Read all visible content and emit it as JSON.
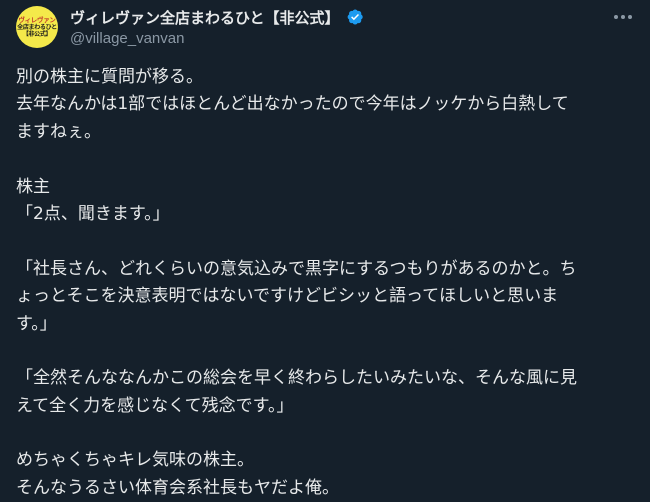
{
  "author": {
    "display_name": "ヴィレヴァン全店まわるひと【非公式】",
    "handle": "@village_vanvan",
    "avatar_text": [
      "ヴィレヴァン",
      "全店まわるひと",
      "【非公式】"
    ],
    "avatar_bg": "#f4e94a",
    "verified": true,
    "verified_color": "#1d9bf0"
  },
  "menu": {
    "icon": "more-horizontal-icon"
  },
  "tweet": {
    "lines": [
      "別の株主に質問が移る。",
      "去年なんかは1部ではほとんど出なかったので今年はノッケから白熱して",
      "ますねぇ。",
      "",
      "株主",
      "「2点、聞きます。」",
      "",
      "「社長さん、どれくらいの意気込みで黒字にするつもりがあるのかと。ち",
      "ょっとそこを決意表明ではないですけどビシッと語ってほしいと思いま",
      "す。」",
      "",
      "「全然そんななんかこの総会を早く終わらしたいみたいな、そんな風に見",
      "えて全く力を感じなくて残念です。」",
      "",
      "めちゃくちゃキレ気味の株主。",
      "そんなうるさい体育会系社長もヤだよ俺。"
    ]
  },
  "colors": {
    "background": "#15202b",
    "text": "#e7e9ea",
    "secondary_text": "#8b98a5"
  }
}
